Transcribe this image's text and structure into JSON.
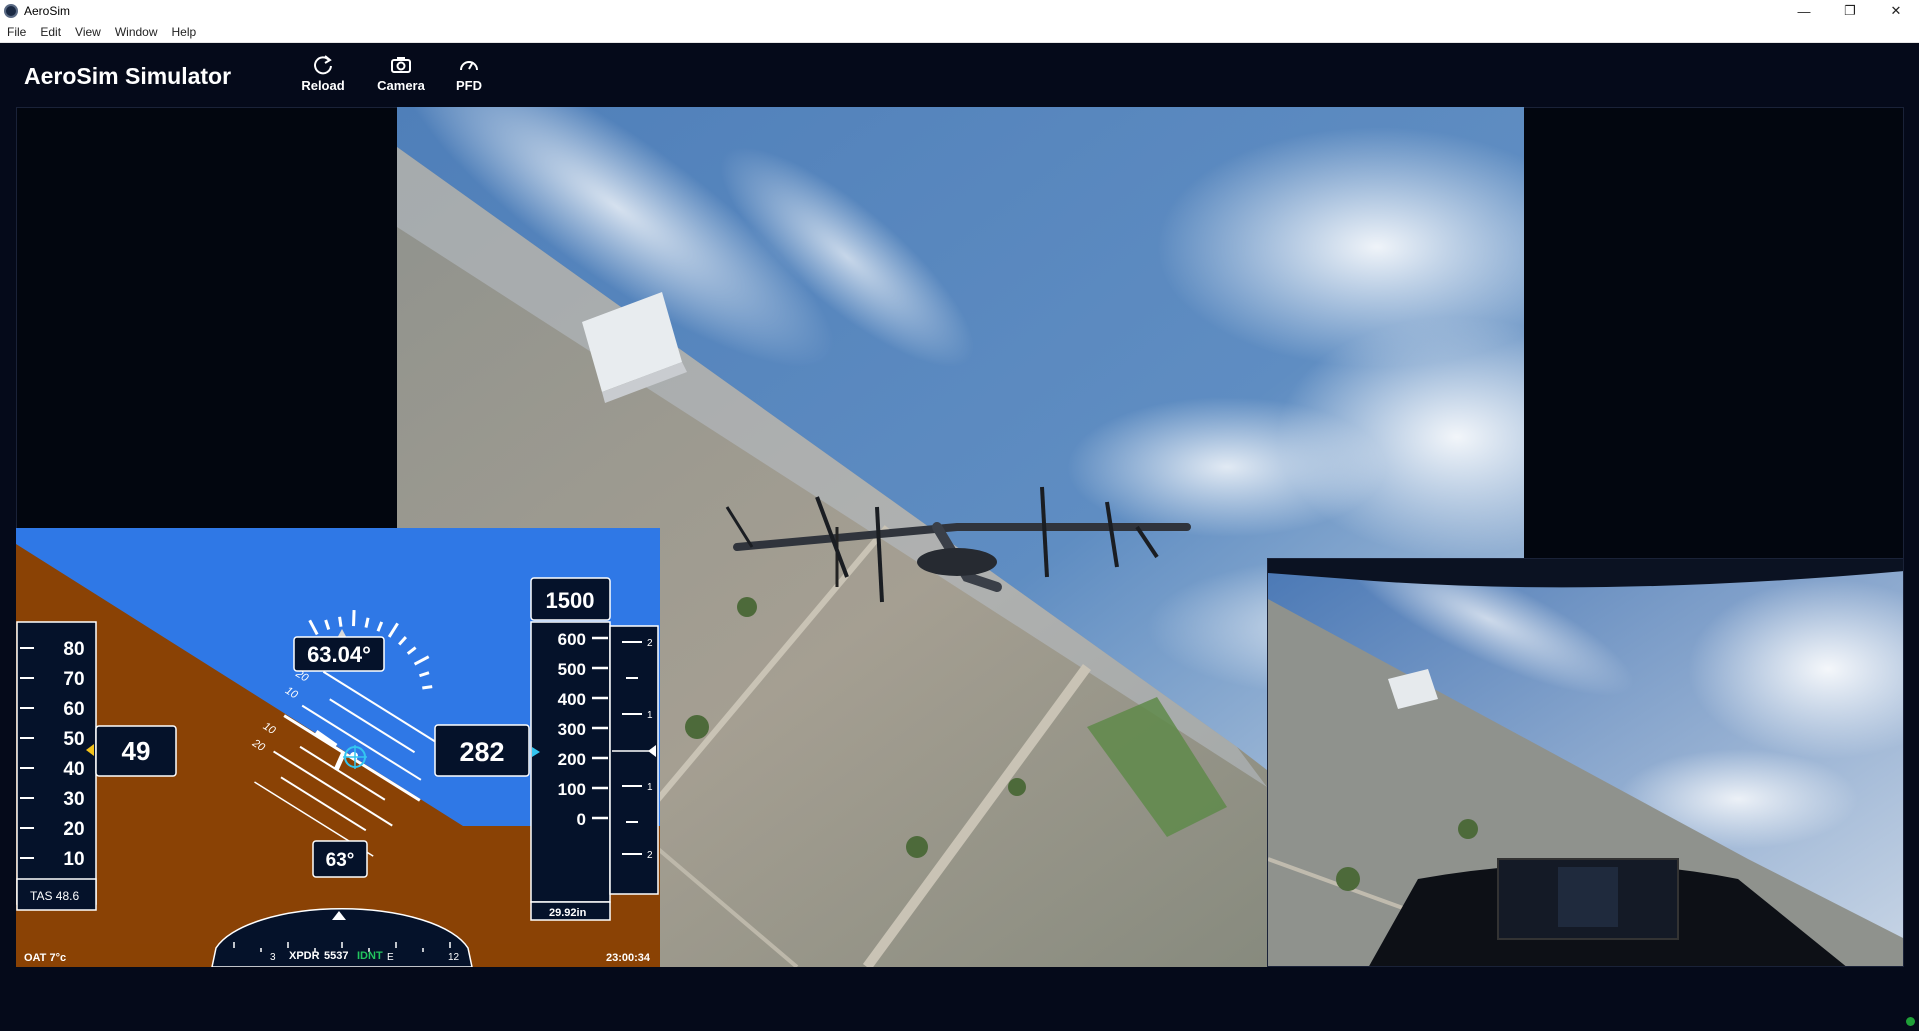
{
  "window": {
    "title": "AeroSim",
    "controls": [
      "—",
      "❐",
      "✕"
    ]
  },
  "menu": [
    "File",
    "Edit",
    "View",
    "Window",
    "Help"
  ],
  "app": {
    "title": "AeroSim Simulator",
    "tools": [
      {
        "label": "Reload",
        "icon": "reload-icon"
      },
      {
        "label": "Camera",
        "icon": "camera-icon"
      },
      {
        "label": "PFD",
        "icon": "gauge-icon"
      }
    ]
  },
  "pfd": {
    "airspeed_ticks": [
      "80",
      "70",
      "60",
      "50",
      "40",
      "30",
      "20",
      "10"
    ],
    "airspeed": "49",
    "tas": "TAS 48.6",
    "bank_angle": "63.04°",
    "pitch_labels": [
      "10",
      "20",
      "10",
      "20"
    ],
    "heading_bug": "282",
    "altitude_selected": "1500",
    "altitude_ticks": [
      "600",
      "500",
      "400",
      "300",
      "200",
      "100",
      "0"
    ],
    "vsi_ticks": [
      "2",
      "1",
      "1",
      "2"
    ],
    "baro": "29.92in",
    "heading": "63°",
    "compass_ticks": [
      "3",
      "E",
      "12"
    ],
    "xpdr_label": "XPDR",
    "xpdr_code": "5537",
    "ident": "IDNT",
    "oat": "OAT 7°c",
    "clock": "23:00:34",
    "colors": {
      "sky": "#2f78e6",
      "ground": "#8a4205",
      "panel": "#05122a"
    }
  },
  "scene": {
    "sky_top": "#3f6fb0",
    "sky_horizon": "#c8d4e6",
    "city": "#8e8f85",
    "aircraft_icon": "evtol-aircraft-icon"
  }
}
